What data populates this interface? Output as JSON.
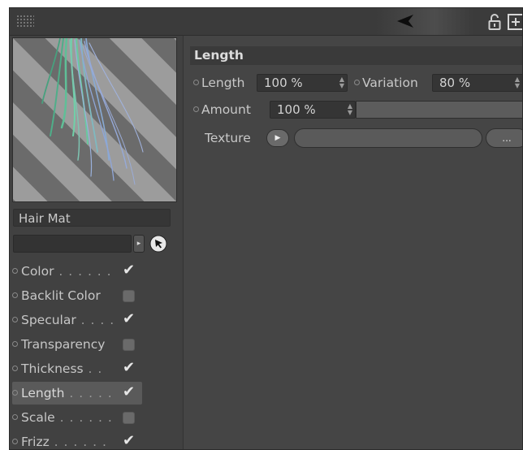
{
  "toolbar": {
    "back_icon": "back-arrow-icon",
    "lock_icon": "lock-icon",
    "new_panel_icon": "new-panel-icon"
  },
  "material": {
    "name": "Hair Mat",
    "layer_value": ""
  },
  "channels": [
    {
      "label": "Color",
      "lead": " . . . . . .",
      "checked": true
    },
    {
      "label": "Backlit Color",
      "lead": "",
      "checked": false
    },
    {
      "label": "Specular",
      "lead": " . . . .",
      "checked": true
    },
    {
      "label": "Transparency",
      "lead": "",
      "checked": false
    },
    {
      "label": "Thickness",
      "lead": " . .",
      "checked": true
    },
    {
      "label": "Length",
      "lead": " . . . . .",
      "checked": true,
      "selected": true
    },
    {
      "label": "Scale",
      "lead": " . . . . . .",
      "checked": false
    },
    {
      "label": "Frizz",
      "lead": " . . . . . .",
      "checked": true
    }
  ],
  "length_panel": {
    "title": "Length",
    "length_label": "Length",
    "length_value": "100 %",
    "variation_label": "Variation",
    "variation_value": "80 %",
    "amount_label": "Amount",
    "amount_value": "100 %",
    "texture_label": "Texture",
    "texture_browse": "..."
  },
  "colors": {
    "panel_bg": "#454545",
    "selected_row": "#5a5a5a",
    "hair_green": "#6fc6a0",
    "hair_blue": "#8fa6d8"
  }
}
